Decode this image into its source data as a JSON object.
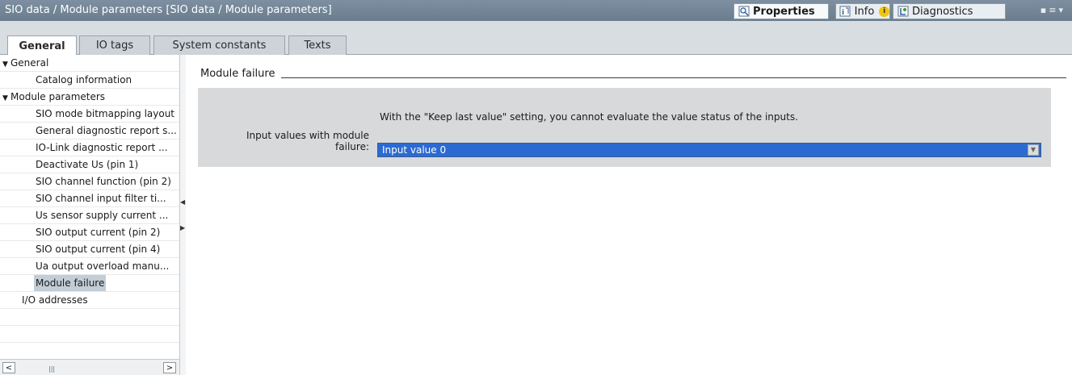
{
  "titlebar": {
    "title": "SIO data / Module parameters [SIO data / Module parameters]",
    "tabs": [
      {
        "label": "Properties",
        "icon": "properties-icon"
      },
      {
        "label": "Info",
        "icon": "info-icon"
      },
      {
        "label": "Diagnostics",
        "icon": "diagnostics-icon"
      }
    ],
    "info_badge": "i"
  },
  "tabs": [
    "General",
    "IO tags",
    "System constants",
    "Texts"
  ],
  "tree": {
    "items": [
      {
        "label": "General",
        "expanded": true
      },
      {
        "label": "Catalog information"
      },
      {
        "label": "Module parameters",
        "expanded": true
      },
      {
        "label": "SIO mode bitmapping layout"
      },
      {
        "label": "General diagnostic report s..."
      },
      {
        "label": "IO-Link diagnostic report ..."
      },
      {
        "label": "Deactivate Us (pin 1)"
      },
      {
        "label": "SIO channel function (pin 2)"
      },
      {
        "label": "SIO channel input filter ti..."
      },
      {
        "label": "Us sensor supply current ..."
      },
      {
        "label": "SIO output current (pin 2)"
      },
      {
        "label": "SIO output current (pin 4)"
      },
      {
        "label": "Ua output overload manu..."
      },
      {
        "label": "Module failure",
        "selected": true
      },
      {
        "label": "I/O addresses"
      }
    ]
  },
  "content": {
    "section_title": "Module failure",
    "info_text": "With the \"Keep last value\" setting, you cannot evaluate the value status of the inputs.",
    "field_label_line1": "Input values with module",
    "field_label_line2": "failure:",
    "field_value": "Input value 0"
  },
  "colors": {
    "titlebar": "#7186a0",
    "selection": "#2b6ad1",
    "panel": "#d7d9db"
  }
}
